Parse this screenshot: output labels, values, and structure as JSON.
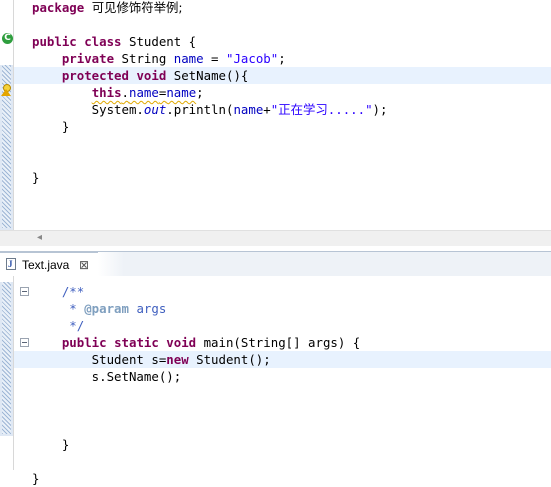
{
  "top_editor": {
    "lines": [
      [
        {
          "t": "package ",
          "c": "kw"
        },
        {
          "t": "可见修饰符举例;",
          "c": "cjk"
        }
      ],
      [],
      [
        {
          "t": "public ",
          "c": "kw"
        },
        {
          "t": "class ",
          "c": "kw"
        },
        {
          "t": "Student {",
          "c": ""
        }
      ],
      [
        {
          "t": "    ",
          "c": ""
        },
        {
          "t": "private ",
          "c": "kw"
        },
        {
          "t": "String ",
          "c": ""
        },
        {
          "t": "name",
          "c": "fld"
        },
        {
          "t": " = ",
          "c": ""
        },
        {
          "t": "\"Jacob\"",
          "c": "str"
        },
        {
          "t": ";",
          "c": ""
        }
      ],
      [
        {
          "t": "    ",
          "c": ""
        },
        {
          "t": "protected ",
          "c": "kw"
        },
        {
          "t": "void ",
          "c": "kw"
        },
        {
          "t": "SetName(){",
          "c": ""
        }
      ],
      [
        {
          "t": "        ",
          "c": ""
        },
        {
          "t": "this",
          "c": "kw warn"
        },
        {
          "t": ".",
          "c": "warn"
        },
        {
          "t": "name",
          "c": "fld warn"
        },
        {
          "t": "=",
          "c": "warn"
        },
        {
          "t": "name",
          "c": "fld warn"
        },
        {
          "t": ";",
          "c": ""
        }
      ],
      [
        {
          "t": "        System.",
          "c": ""
        },
        {
          "t": "out",
          "c": "sfld"
        },
        {
          "t": ".println(",
          "c": ""
        },
        {
          "t": "name",
          "c": "fld"
        },
        {
          "t": "+",
          "c": ""
        },
        {
          "t": "\"",
          "c": "str"
        },
        {
          "t": "正在学习",
          "c": "str cjk"
        },
        {
          "t": ".....\"",
          "c": "str"
        },
        {
          "t": ");",
          "c": ""
        }
      ],
      [
        {
          "t": "    }",
          "c": ""
        }
      ],
      [],
      [],
      [
        {
          "t": "}",
          "c": ""
        }
      ]
    ]
  },
  "editor_tab": {
    "file_name": "Text.java",
    "close_glyph": "⊠",
    "icon_letter": "J"
  },
  "bottom_editor": {
    "lines": [
      [
        {
          "t": "    ",
          "c": ""
        },
        {
          "t": "/**",
          "c": "doc"
        }
      ],
      [
        {
          "t": "     * ",
          "c": "doc"
        },
        {
          "t": "@param",
          "c": "tag"
        },
        {
          "t": " args",
          "c": "doc"
        }
      ],
      [
        {
          "t": "     */",
          "c": "doc"
        }
      ],
      [
        {
          "t": "    ",
          "c": ""
        },
        {
          "t": "public ",
          "c": "kw"
        },
        {
          "t": "static ",
          "c": "kw"
        },
        {
          "t": "void ",
          "c": "kw"
        },
        {
          "t": "main(String[] args) {",
          "c": ""
        }
      ],
      [
        {
          "t": "        Student s=",
          "c": ""
        },
        {
          "t": "new ",
          "c": "kw"
        },
        {
          "t": "Student();",
          "c": ""
        }
      ],
      [
        {
          "t": "        s.SetName();",
          "c": ""
        }
      ],
      [],
      [],
      [],
      [
        {
          "t": "    }",
          "c": ""
        }
      ],
      [],
      [
        {
          "t": "}",
          "c": ""
        }
      ]
    ]
  },
  "gutter_icons": {
    "override": "override-indicator-icon",
    "warning": "warning-lightbulb-icon",
    "fold": "fold-collapse-icon"
  },
  "colors": {
    "keyword": "#7f0055",
    "string": "#2a00ff",
    "field": "#0000c0",
    "javadoc": "#3f5fbf",
    "current_line": "#e8f2fe"
  }
}
